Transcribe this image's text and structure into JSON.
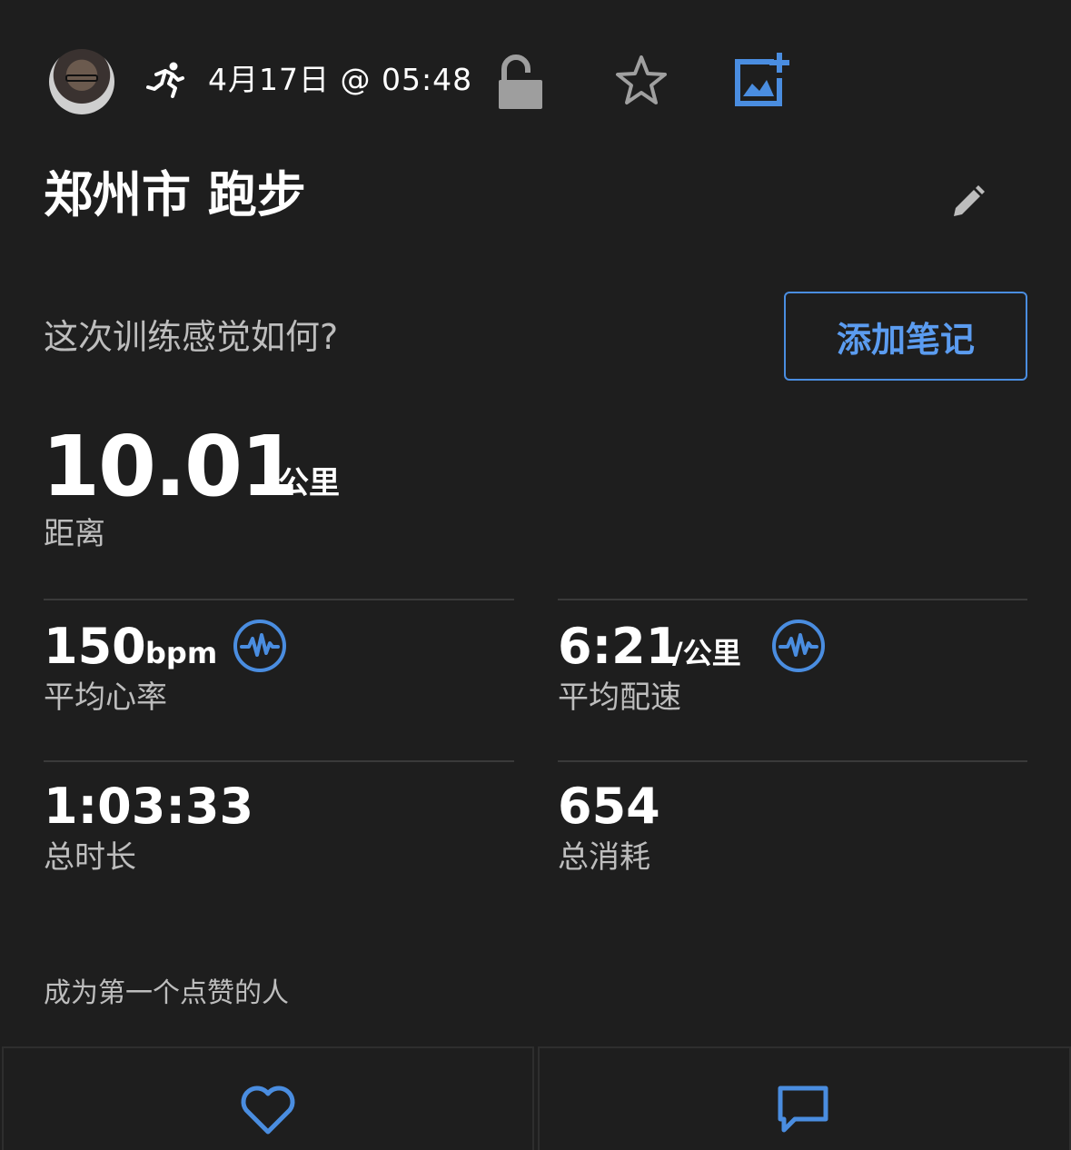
{
  "header": {
    "date": "4月17日 @ 05:48",
    "avatar_icon": "user-avatar",
    "activity_icon": "running-icon",
    "lock_icon": "unlocked-icon",
    "star_icon": "star-icon",
    "photo_icon": "add-photo-icon"
  },
  "activity": {
    "title": "郑州市 跑步",
    "edit_icon": "pencil-icon"
  },
  "feeling": {
    "question": "这次训练感觉如何?",
    "add_note_label": "添加笔记"
  },
  "distance": {
    "value": "10.01",
    "unit": "公里",
    "label": "距离"
  },
  "stats": {
    "heart_rate": {
      "value": "150",
      "unit": "bpm",
      "label": "平均心率",
      "icon": "heart-rate-wave-icon"
    },
    "pace": {
      "value": "6:21",
      "unit": "/公里",
      "label": "平均配速",
      "icon": "pace-wave-icon"
    },
    "duration": {
      "value": "1:03:33",
      "label": "总时长"
    },
    "calories": {
      "value": "654",
      "label": "总消耗"
    }
  },
  "social": {
    "likes_text": "成为第一个点赞的人",
    "like_icon": "heart-icon",
    "comment_icon": "comment-icon"
  },
  "colors": {
    "background": "#1e1e1e",
    "accent": "#4a8de0",
    "text": "#ffffff",
    "muted_text": "#bdbdbd",
    "icon_grey": "#a0a0a0"
  }
}
